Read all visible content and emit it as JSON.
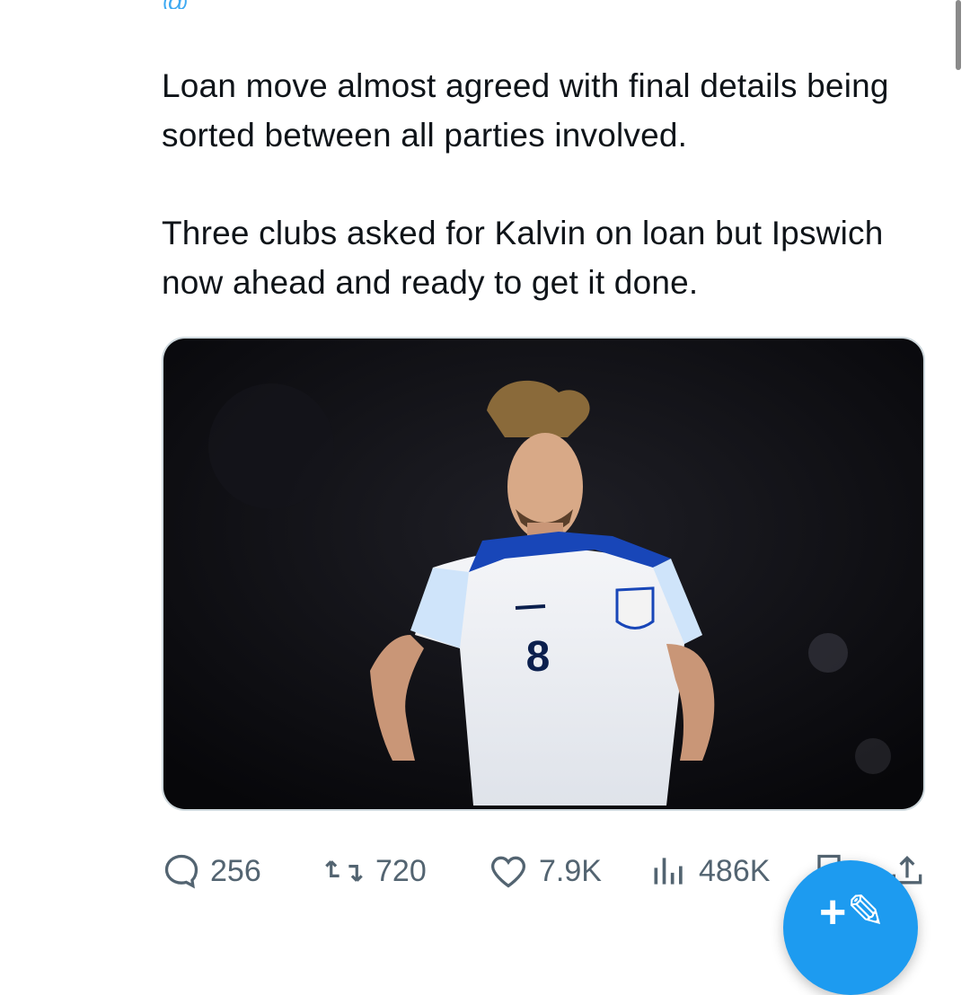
{
  "tweet": {
    "handle_partial": "@ ",
    "paragraphs": [
      "Loan move almost agreed with final details being sorted between all parties involved.",
      "Three clubs asked for Kalvin on loan but Ipswich now ahead and ready to get it done."
    ],
    "media": {
      "shirt_number": "8"
    }
  },
  "actions": {
    "replies": "256",
    "retweets": "720",
    "likes": "7.9K",
    "views": "486K"
  },
  "icons": {
    "reply": "reply-icon",
    "retweet": "retweet-icon",
    "like": "heart-icon",
    "views": "views-icon",
    "bookmark": "bookmark-icon",
    "share": "share-icon",
    "compose": "compose-icon"
  },
  "colors": {
    "accent": "#1d9bf0",
    "text": "#0f1419",
    "muted": "#536471"
  }
}
